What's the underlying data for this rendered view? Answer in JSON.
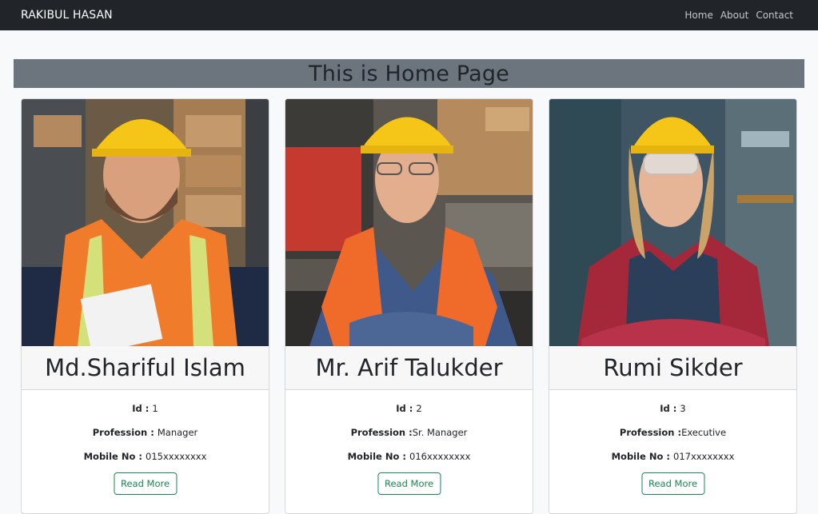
{
  "navbar": {
    "brand": "RAKIBUL HASAN",
    "links": [
      "Home",
      "About",
      "Contact"
    ]
  },
  "page_heading": "This is Home Page",
  "cards": [
    {
      "name": "Md.Shariful Islam",
      "id_label": "Id : ",
      "id": "1",
      "profession_label": "Profession : ",
      "profession": "Manager",
      "mobile_label": "Mobile No : ",
      "mobile": "015xxxxxxxx",
      "button": "Read More"
    },
    {
      "name": "Mr. Arif Talukder",
      "id_label": "Id : ",
      "id": "2",
      "profession_label": "Profession :",
      "profession": "Sr. Manager",
      "mobile_label": "Mobile No : ",
      "mobile": "016xxxxxxxx",
      "button": "Read More"
    },
    {
      "name": "Rumi Sikder",
      "id_label": "Id : ",
      "id": "3",
      "profession_label": "Profession :",
      "profession": "Executive",
      "mobile_label": "Mobile No : ",
      "mobile": "017xxxxxxxx",
      "button": "Read More"
    }
  ],
  "colors": {
    "navbar_bg": "#212529",
    "banner_bg": "#6c757d",
    "button_accent": "#198754"
  }
}
